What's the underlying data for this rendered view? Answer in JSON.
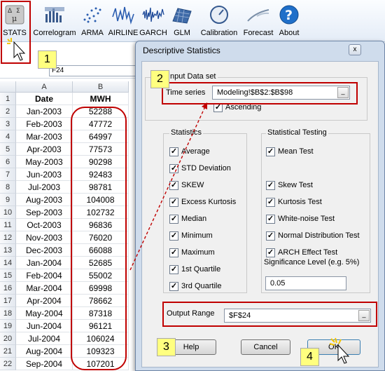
{
  "ribbon": {
    "buttons": [
      {
        "label": "STATS",
        "icon": "stats-icon"
      },
      {
        "label": "Correlogram",
        "icon": "correlogram-icon"
      },
      {
        "label": "ARMA",
        "icon": "arma-icon"
      },
      {
        "label": "AIRLINE",
        "icon": "airline-icon"
      },
      {
        "label": "GARCH",
        "icon": "garch-icon"
      },
      {
        "label": "GLM",
        "icon": "glm-icon"
      },
      {
        "label": "Calibration",
        "icon": "calibration-icon"
      },
      {
        "label": "Forecast",
        "icon": "forecast-icon"
      },
      {
        "label": "About",
        "icon": "about-icon"
      }
    ]
  },
  "callouts": {
    "one": "1",
    "two": "2",
    "three": "3",
    "four": "4"
  },
  "sheet": {
    "namebox": "F24",
    "col_headers": [
      "A",
      "B"
    ],
    "rows": [
      {
        "n": "1",
        "a": "Date",
        "b": "MWH"
      },
      {
        "n": "2",
        "a": "Jan-2003",
        "b": "52288"
      },
      {
        "n": "3",
        "a": "Feb-2003",
        "b": "47772"
      },
      {
        "n": "4",
        "a": "Mar-2003",
        "b": "64997"
      },
      {
        "n": "5",
        "a": "Apr-2003",
        "b": "77573"
      },
      {
        "n": "6",
        "a": "May-2003",
        "b": "90298"
      },
      {
        "n": "7",
        "a": "Jun-2003",
        "b": "92483"
      },
      {
        "n": "8",
        "a": "Jul-2003",
        "b": "98781"
      },
      {
        "n": "9",
        "a": "Aug-2003",
        "b": "104008"
      },
      {
        "n": "10",
        "a": "Sep-2003",
        "b": "102732"
      },
      {
        "n": "11",
        "a": "Oct-2003",
        "b": "96836"
      },
      {
        "n": "12",
        "a": "Nov-2003",
        "b": "76020"
      },
      {
        "n": "13",
        "a": "Dec-2003",
        "b": "66088"
      },
      {
        "n": "14",
        "a": "Jan-2004",
        "b": "52685"
      },
      {
        "n": "15",
        "a": "Feb-2004",
        "b": "55002"
      },
      {
        "n": "16",
        "a": "Mar-2004",
        "b": "69998"
      },
      {
        "n": "17",
        "a": "Apr-2004",
        "b": "78662"
      },
      {
        "n": "18",
        "a": "May-2004",
        "b": "87318"
      },
      {
        "n": "19",
        "a": "Jun-2004",
        "b": "96121"
      },
      {
        "n": "20",
        "a": "Jul-2004",
        "b": "106024"
      },
      {
        "n": "21",
        "a": "Aug-2004",
        "b": "109323"
      },
      {
        "n": "22",
        "a": "Sep-2004",
        "b": "107201"
      }
    ]
  },
  "dialog": {
    "title": "Descriptive Statistics",
    "close": "x",
    "input_group": "Input Data set",
    "time_series_label": "Time series",
    "time_series_value": "Modeling!$B$2:$B$98",
    "ascending_label": "Ascending",
    "ascending_checked": true,
    "statistics_group": "Statistics",
    "statistics": [
      {
        "label": "Average",
        "checked": true
      },
      {
        "label": "STD Deviation",
        "checked": true
      },
      {
        "label": "SKEW",
        "checked": true
      },
      {
        "label": "Excess Kurtosis",
        "checked": true
      },
      {
        "label": "Median",
        "checked": true
      },
      {
        "label": "Minimum",
        "checked": true
      },
      {
        "label": "Maximum",
        "checked": true
      },
      {
        "label": "1st Quartile",
        "checked": true
      },
      {
        "label": "3rd Quartile",
        "checked": true
      }
    ],
    "testing_group": "Statistical Testing",
    "tests": [
      {
        "label": "Mean Test",
        "checked": true
      },
      {
        "label": "Skew Test",
        "checked": true
      },
      {
        "label": "Kurtosis Test",
        "checked": true
      },
      {
        "label": "White-noise Test",
        "checked": true
      },
      {
        "label": "Normal Distribution Test",
        "checked": true
      },
      {
        "label": "ARCH Effect Test",
        "checked": true
      }
    ],
    "significance_label": "Significance Level (e.g. 5%)",
    "significance_value": "0.05",
    "output_label": "Output Range",
    "output_value": "$F$24",
    "help_label": "Help",
    "cancel_label": "Cancel",
    "ok_label": "OK"
  },
  "colors": {
    "highlight": "#c00000",
    "callout": "#ffff7f"
  }
}
